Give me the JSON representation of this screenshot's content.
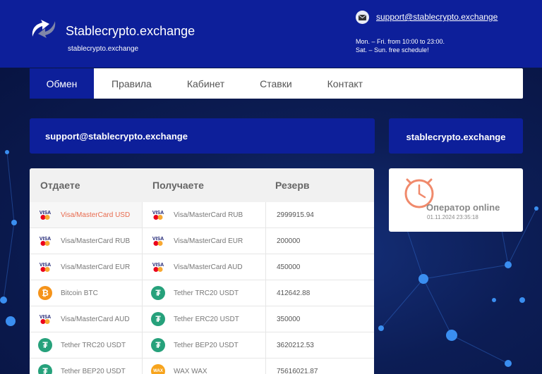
{
  "header": {
    "site_title": "Stablecrypto.exchange",
    "site_subtitle": "stablecrypto.exchange",
    "support_email": "support@stablecrypto.exchange",
    "hours_weekday": "Mon. – Fri. from 10:00 to 23:00.",
    "hours_weekend": "Sat. – Sun. free schedule!"
  },
  "nav": {
    "items": [
      "Обмен",
      "Правила",
      "Кабинет",
      "Ставки",
      "Контакт"
    ],
    "active": "Обмен"
  },
  "support_box": {
    "email": "support@stablecrypto.exchange"
  },
  "site_box": {
    "label": "stablecrypto.exchange"
  },
  "operator": {
    "status": "Оператор online",
    "datetime": "01.11.2024 23:35:18"
  },
  "table": {
    "headers": [
      "Отдаете",
      "Получаете",
      "Резерв"
    ],
    "rows": [
      {
        "give": "Visa/MasterCard USD",
        "give_icon": "visa-mastercard-icon",
        "get": "Visa/MasterCard RUB",
        "get_icon": "visa-mastercard-icon",
        "reserve": "2999915.94"
      },
      {
        "give": "Visa/MasterCard RUB",
        "give_icon": "visa-mastercard-icon",
        "get": "Visa/MasterCard EUR",
        "get_icon": "visa-mastercard-icon",
        "reserve": "200000"
      },
      {
        "give": "Visa/MasterCard EUR",
        "give_icon": "visa-mastercard-icon",
        "get": "Visa/MasterCard AUD",
        "get_icon": "visa-mastercard-icon",
        "reserve": "450000"
      },
      {
        "give": "Bitcoin BTC",
        "give_icon": "bitcoin-icon",
        "get": "Tether TRC20 USDT",
        "get_icon": "tether-icon",
        "reserve": "412642.88"
      },
      {
        "give": "Visa/MasterCard AUD",
        "give_icon": "visa-mastercard-icon",
        "get": "Tether ERC20 USDT",
        "get_icon": "tether-icon",
        "reserve": "350000"
      },
      {
        "give": "Tether TRC20 USDT",
        "give_icon": "tether-icon",
        "get": "Tether BEP20 USDT",
        "get_icon": "tether-icon",
        "reserve": "3620212.53"
      },
      {
        "give": "Tether BEP20 USDT",
        "give_icon": "tether-icon",
        "get": "WAX WAX",
        "get_icon": "wax-icon",
        "reserve": "75616021.87"
      }
    ]
  },
  "colors": {
    "primary": "#0d1f9a",
    "accent": "#e86a4e",
    "background": "#0b1a4a"
  }
}
